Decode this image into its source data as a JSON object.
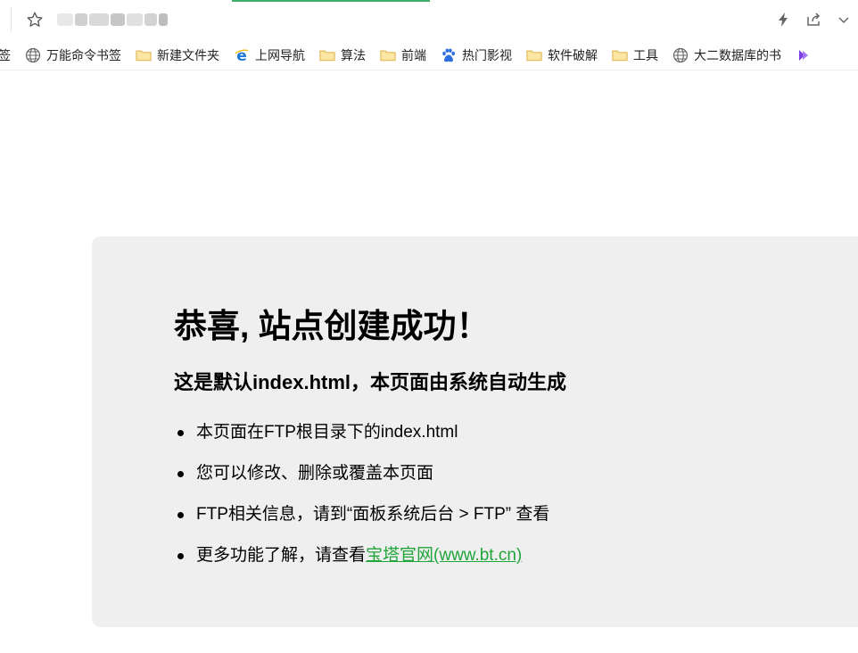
{
  "bookmarks": [
    {
      "label": "签",
      "icon": "none"
    },
    {
      "label": "万能命令书签",
      "icon": "globe-icon"
    },
    {
      "label": "新建文件夹",
      "icon": "folder-icon"
    },
    {
      "label": "上网导航",
      "icon": "ie-icon"
    },
    {
      "label": "算法",
      "icon": "folder-icon"
    },
    {
      "label": "前端",
      "icon": "folder-icon"
    },
    {
      "label": "热门影视",
      "icon": "paw-icon"
    },
    {
      "label": "软件破解",
      "icon": "folder-icon"
    },
    {
      "label": "工具",
      "icon": "folder-icon"
    },
    {
      "label": "大二数据库的书",
      "icon": "globe-icon"
    }
  ],
  "colors": {
    "card_bg": "#efefef",
    "link": "#20a53a",
    "folder": "#f6d36b",
    "accent_green": "#3fae6b"
  },
  "card": {
    "title": "恭喜, 站点创建成功！",
    "subtitle": "这是默认index.html，本页面由系统自动生成",
    "items": [
      {
        "text": "本页面在FTP根目录下的index.html"
      },
      {
        "text": "您可以修改、删除或覆盖本页面"
      },
      {
        "text": "FTP相关信息，请到“面板系统后台 > FTP” 查看"
      },
      {
        "text": "更多功能了解，请查看",
        "link": "宝塔官网(www.bt.cn)"
      }
    ]
  }
}
